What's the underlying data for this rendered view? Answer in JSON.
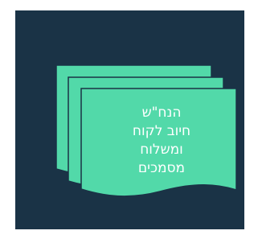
{
  "diagram": {
    "shape_type": "multi-document",
    "fill_color": "#52d9a9",
    "stroke_color": "#1a3346",
    "background_color": "#1a3346",
    "text_lines": [
      "הנח\"ש",
      "חיוב לקוח",
      "ומשלוח",
      "מסמכים"
    ]
  }
}
